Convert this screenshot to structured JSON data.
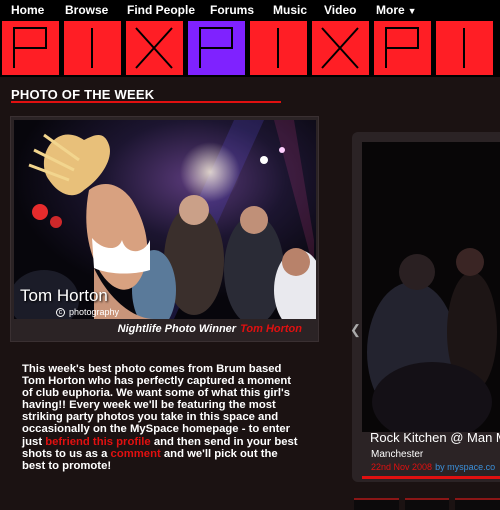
{
  "nav": {
    "items": [
      {
        "label": "Home"
      },
      {
        "label": "Browse"
      },
      {
        "label": "Find People"
      },
      {
        "label": "Forums"
      },
      {
        "label": "Music"
      },
      {
        "label": "Video"
      },
      {
        "label": "More"
      }
    ],
    "more_caret_icon": "caret-down-icon"
  },
  "banner": {
    "letters": [
      "P",
      "I",
      "X",
      "P",
      "I",
      "X",
      "P",
      "I"
    ],
    "colors": {
      "red": "#ff1e25",
      "purple": "#7f22ff",
      "stroke": "#000000"
    }
  },
  "section": {
    "title": "PHOTO OF THE WEEK",
    "accent": "#e01010"
  },
  "photo": {
    "credit_name": "Tom Horton",
    "credit_sub": "photography",
    "copyright_symbol": "c",
    "caption_prefix": "Nightlife Photo Winner",
    "caption_winner": "Tom Horton"
  },
  "blurb": {
    "part1": "This week's best photo comes from Brum based Tom Horton who has perfectly captured a moment of club euphoria. We want some of what this girl's having!! Every week we'll be featuring the most striking party photos you take in this space and occasionally on the MySpace homepage - to enter just ",
    "link1": "befriend this profile",
    "part2": " and then send in your best shots to us as a ",
    "link2": "comment",
    "part3": " and we'll pick out the best to promote!"
  },
  "carousel": {
    "prev_icon": "chevron-left-icon",
    "item_title": "Rock Kitchen @ Man M",
    "item_place": "Manchester",
    "item_date": "22nd Nov 2008",
    "item_source": "by myspace.co"
  }
}
